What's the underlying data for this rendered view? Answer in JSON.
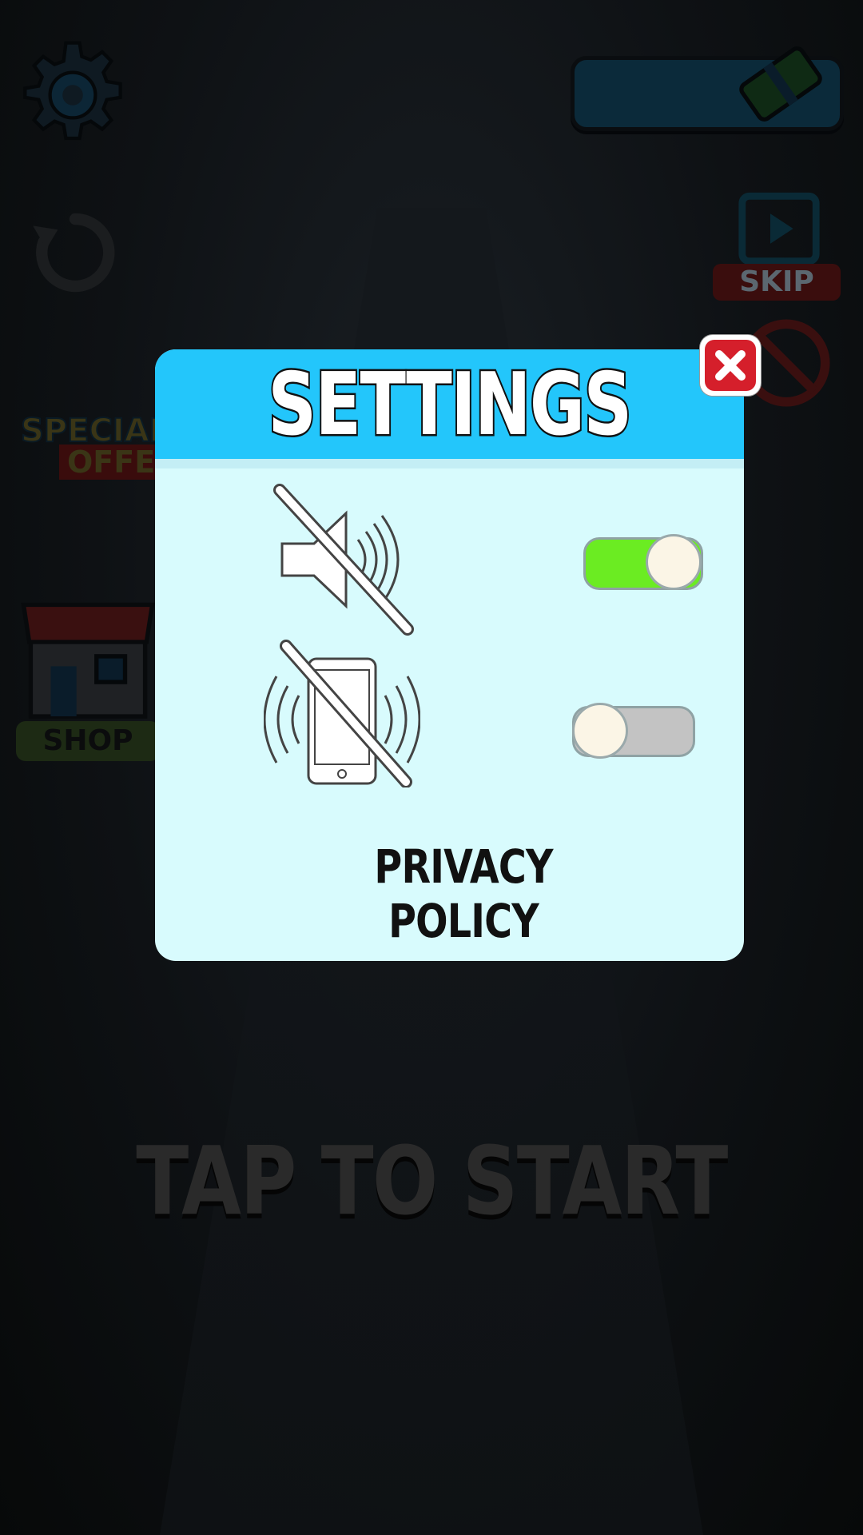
{
  "background": {
    "shop_label": "SHOP",
    "skip_label": "SKIP",
    "special_offer_line1": "SPECIAL",
    "special_offer_line2": "OFFE",
    "tap_to_start": "TAP TO START"
  },
  "modal": {
    "title": "SETTINGS",
    "sound_toggle_on": true,
    "vibration_toggle_on": false,
    "privacy_policy": "PRIVACY POLICY"
  },
  "colors": {
    "header": "#23c6fb",
    "panel": "#d8fbfd",
    "toggle_on": "#6bec22",
    "toggle_off": "#c3c3c3",
    "close": "#d51f2b"
  },
  "icons": [
    "gear-icon",
    "money-icon",
    "restart-icon",
    "skip-video-icon",
    "no-ads-icon",
    "shop-icon",
    "sound-muted-icon",
    "vibration-off-icon",
    "close-icon"
  ]
}
